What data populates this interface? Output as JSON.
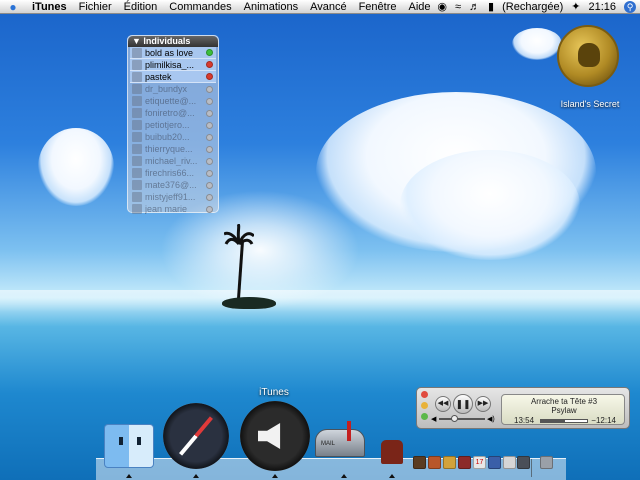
{
  "menubar": {
    "app_name": "iTunes",
    "items": [
      "Fichier",
      "Édition",
      "Commandes",
      "Animations",
      "Avancé",
      "Fenêtre",
      "Aide"
    ],
    "battery_status": "(Rechargée)",
    "clock": "21:16"
  },
  "buddy_list": {
    "title": "Individuals",
    "buddies": [
      {
        "name": "bold as love",
        "status": "available"
      },
      {
        "name": "plimilkisa_...",
        "status": "away"
      },
      {
        "name": "pastek",
        "status": "away"
      },
      {
        "name": "dr_bundyx",
        "status": "offline"
      },
      {
        "name": "etiquette@...",
        "status": "offline"
      },
      {
        "name": "foniretro@...",
        "status": "offline"
      },
      {
        "name": "petiotjero...",
        "status": "offline"
      },
      {
        "name": "buibub20...",
        "status": "offline"
      },
      {
        "name": "thierryque...",
        "status": "offline"
      },
      {
        "name": "michael_riv...",
        "status": "offline"
      },
      {
        "name": "firechris66...",
        "status": "offline"
      },
      {
        "name": "mate376@...",
        "status": "offline"
      },
      {
        "name": "mistyjeff91...",
        "status": "offline"
      },
      {
        "name": "jean marie",
        "status": "offline"
      }
    ]
  },
  "desktop_icon": {
    "label": "Island's Secret",
    "icon": "pirate-coin-disk-icon"
  },
  "mini_player": {
    "track": "Arrache ta Tête #3",
    "artist": "Psylaw",
    "elapsed": "13:54",
    "remaining": "−12:14",
    "progress_fraction": 0.53,
    "volume_fraction": 0.3
  },
  "dock": {
    "hover_label": "iTunes",
    "apps": [
      "Finder",
      "Safari",
      "iTunes",
      "Mail",
      "Domo"
    ]
  },
  "colors": {
    "available": "#3cbf3c",
    "away": "#d83a2e",
    "offline": "#b8bcc4",
    "accent": "#2b73d6"
  }
}
